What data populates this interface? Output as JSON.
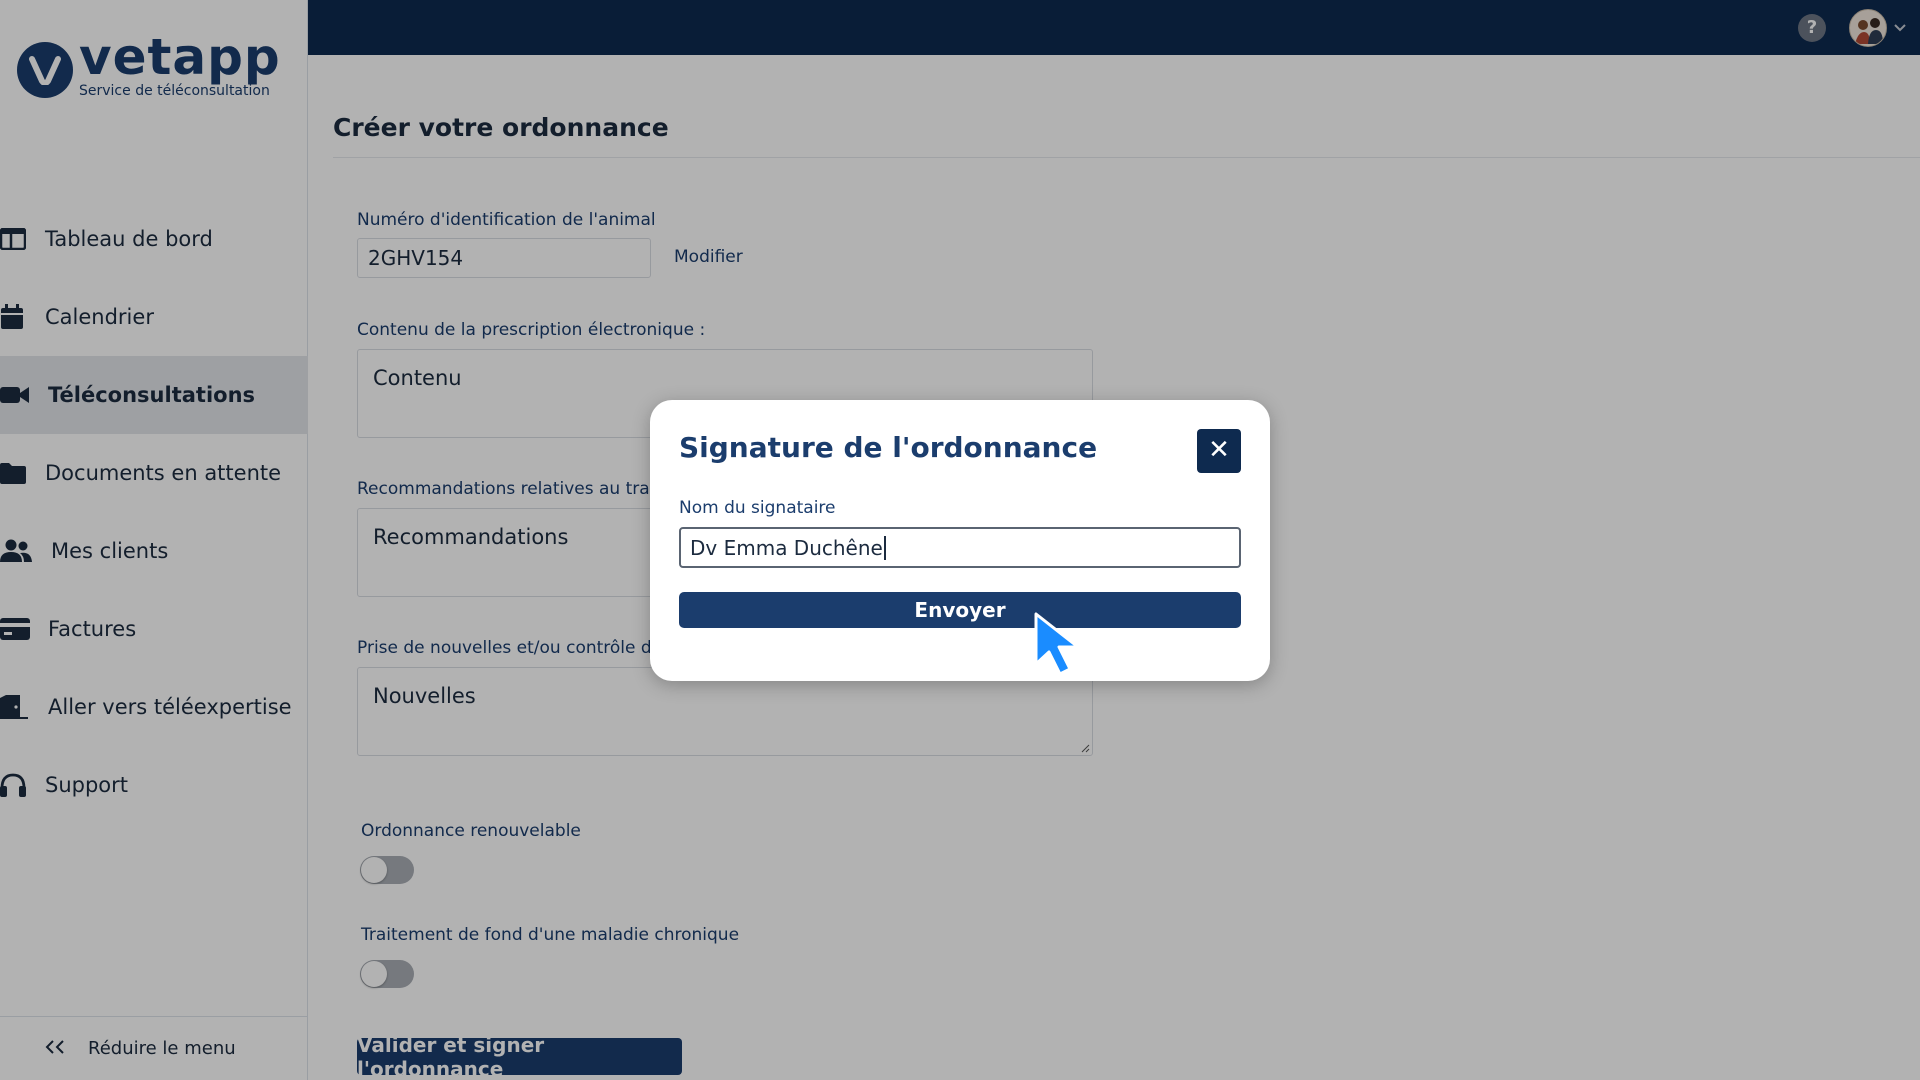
{
  "app": {
    "brand_name": "vetapp",
    "brand_tagline": "Service de téléconsultation"
  },
  "colors": {
    "brand_navy": "#1b3d6d",
    "topbar_navy": "#0e2a4f",
    "active_nav_bg": "#e3e6ea",
    "cursor_blue": "#1a8cff"
  },
  "sidebar": {
    "items": [
      {
        "label": "Tableau de bord",
        "icon": "dashboard-icon",
        "active": false
      },
      {
        "label": "Calendrier",
        "icon": "calendar-icon",
        "active": false
      },
      {
        "label": "Téléconsultations",
        "icon": "video-camera-icon",
        "active": true
      },
      {
        "label": "Documents en attente",
        "icon": "folder-icon",
        "active": false
      },
      {
        "label": "Mes clients",
        "icon": "users-icon",
        "active": false
      },
      {
        "label": "Factures",
        "icon": "credit-card-icon",
        "active": false
      },
      {
        "label": "Aller vers téléexpertise",
        "icon": "door-exit-icon",
        "active": false
      },
      {
        "label": "Support",
        "icon": "headset-icon",
        "active": false
      }
    ],
    "collapse_label": "Réduire le menu",
    "collapse_icon": "double-chevron-left-icon"
  },
  "topbar": {
    "help_glyph": "?",
    "help_icon": "help-icon",
    "avatar_icon": "user-avatar",
    "avatar_caret_icon": "chevron-down-icon"
  },
  "form": {
    "title": "Créer votre ordonnance",
    "animal_id_label": "Numéro d'identification de l'animal",
    "animal_id_value": "2GHV154",
    "modifier_label": "Modifier",
    "content_label": "Contenu de la prescription électronique :",
    "content_placeholder": "Contenu",
    "recommendations_label": "Recommandations relatives au tra",
    "recommendations_placeholder": "Recommandations",
    "news_label": "Prise de nouvelles et/ou contrôle de",
    "news_placeholder": "Nouvelles",
    "renewable_label": "Ordonnance renouvelable",
    "renewable_on": false,
    "chronic_label": "Traitement de fond d'une maladie chronique",
    "chronic_on": false,
    "submit_label": "Valider et signer l'ordonnance"
  },
  "modal": {
    "title": "Signature de l'ordonnance",
    "close_glyph": "✕",
    "signer_label": "Nom du signataire",
    "signer_value": "Dv Emma Duchêne",
    "send_label": "Envoyer"
  }
}
